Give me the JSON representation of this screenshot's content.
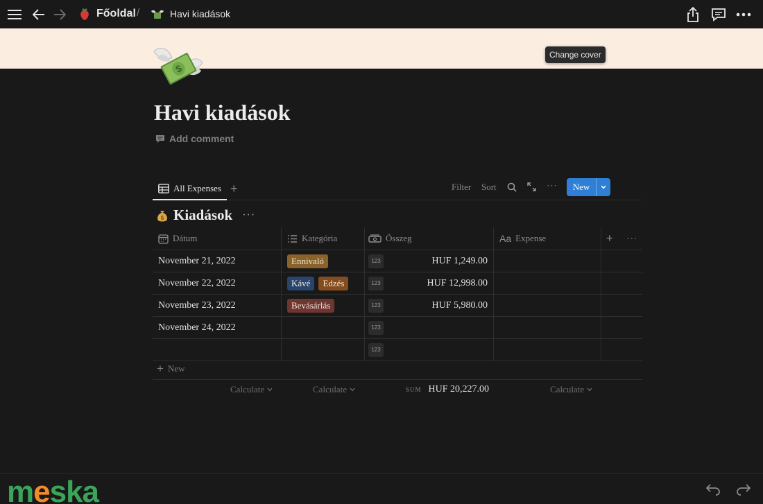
{
  "topbar": {
    "breadcrumb_root": "Főoldal",
    "breadcrumb_page": "Havi kiadások"
  },
  "cover": {
    "change_cover_label": "Change cover"
  },
  "page": {
    "title": "Havi kiadások",
    "add_comment": "Add comment"
  },
  "views": {
    "tab_label": "All Expenses",
    "filter": "Filter",
    "sort": "Sort",
    "new_button": "New"
  },
  "database": {
    "title": "Kiadások",
    "columns": [
      "Dátum",
      "Kategória",
      "Összeg",
      "Expense"
    ],
    "rows": [
      {
        "date": "November 21, 2022",
        "tags": [
          {
            "label": "Ennivaló",
            "color": "#89632a"
          }
        ],
        "badge": "123",
        "amount": "HUF 1,249.00",
        "expense": ""
      },
      {
        "date": "November 22, 2022",
        "tags": [
          {
            "label": "Kávé",
            "color": "#28456c"
          },
          {
            "label": "Edzés",
            "color": "#854c1d"
          }
        ],
        "badge": "123",
        "amount": "HUF 12,998.00",
        "expense": ""
      },
      {
        "date": "November 23, 2022",
        "tags": [
          {
            "label": "Bevásárlás",
            "color": "#6e3630"
          }
        ],
        "badge": "123",
        "amount": "HUF 5,980.00",
        "expense": ""
      },
      {
        "date": "November 24, 2022",
        "tags": [],
        "badge": "123",
        "amount": "",
        "expense": ""
      },
      {
        "date": "",
        "tags": [],
        "badge": "123",
        "amount": "",
        "expense": ""
      }
    ],
    "new_row_label": "New",
    "calc_labels": [
      "Calculate",
      "Calculate",
      "Calculate"
    ],
    "sum_label": "SUM",
    "sum_value": "HUF 20,227.00"
  },
  "watermark": {
    "text_a": "m",
    "text_b": "e",
    "text_c": "ska"
  },
  "colors": {
    "accent": "#2f7fd6",
    "background": "#191919",
    "cover": "#fbeee1"
  }
}
